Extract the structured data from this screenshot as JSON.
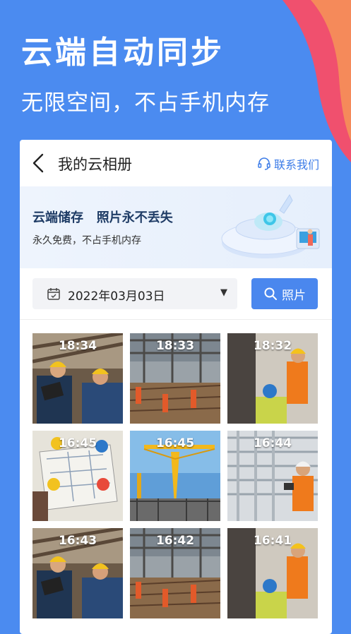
{
  "hero": {
    "title": "云端自动同步",
    "subtitle": "无限空间，不占手机内存"
  },
  "header": {
    "title": "我的云相册",
    "contact_label": "联系我们"
  },
  "banner": {
    "headline": "云端储存   照片永不丢失",
    "subline": "永久免费，不占手机内存"
  },
  "filter": {
    "date": "2022年03月03日",
    "search_label": "照片"
  },
  "photos": [
    {
      "time": "18:34",
      "scene": "engineers-with-tablet"
    },
    {
      "time": "18:33",
      "scene": "rebar-site"
    },
    {
      "time": "18:32",
      "scene": "worker-at-wall"
    },
    {
      "time": "16:45",
      "scene": "blueprint-table"
    },
    {
      "time": "16:45",
      "scene": "tower-crane"
    },
    {
      "time": "16:44",
      "scene": "building-facade"
    },
    {
      "time": "16:43",
      "scene": "engineers-with-tablet"
    },
    {
      "time": "16:42",
      "scene": "rebar-site"
    },
    {
      "time": "16:41",
      "scene": "worker-at-wall"
    }
  ],
  "colors": {
    "background": "#4b8bf0",
    "accent": "#4a87ee",
    "link": "#3c7ce8"
  }
}
